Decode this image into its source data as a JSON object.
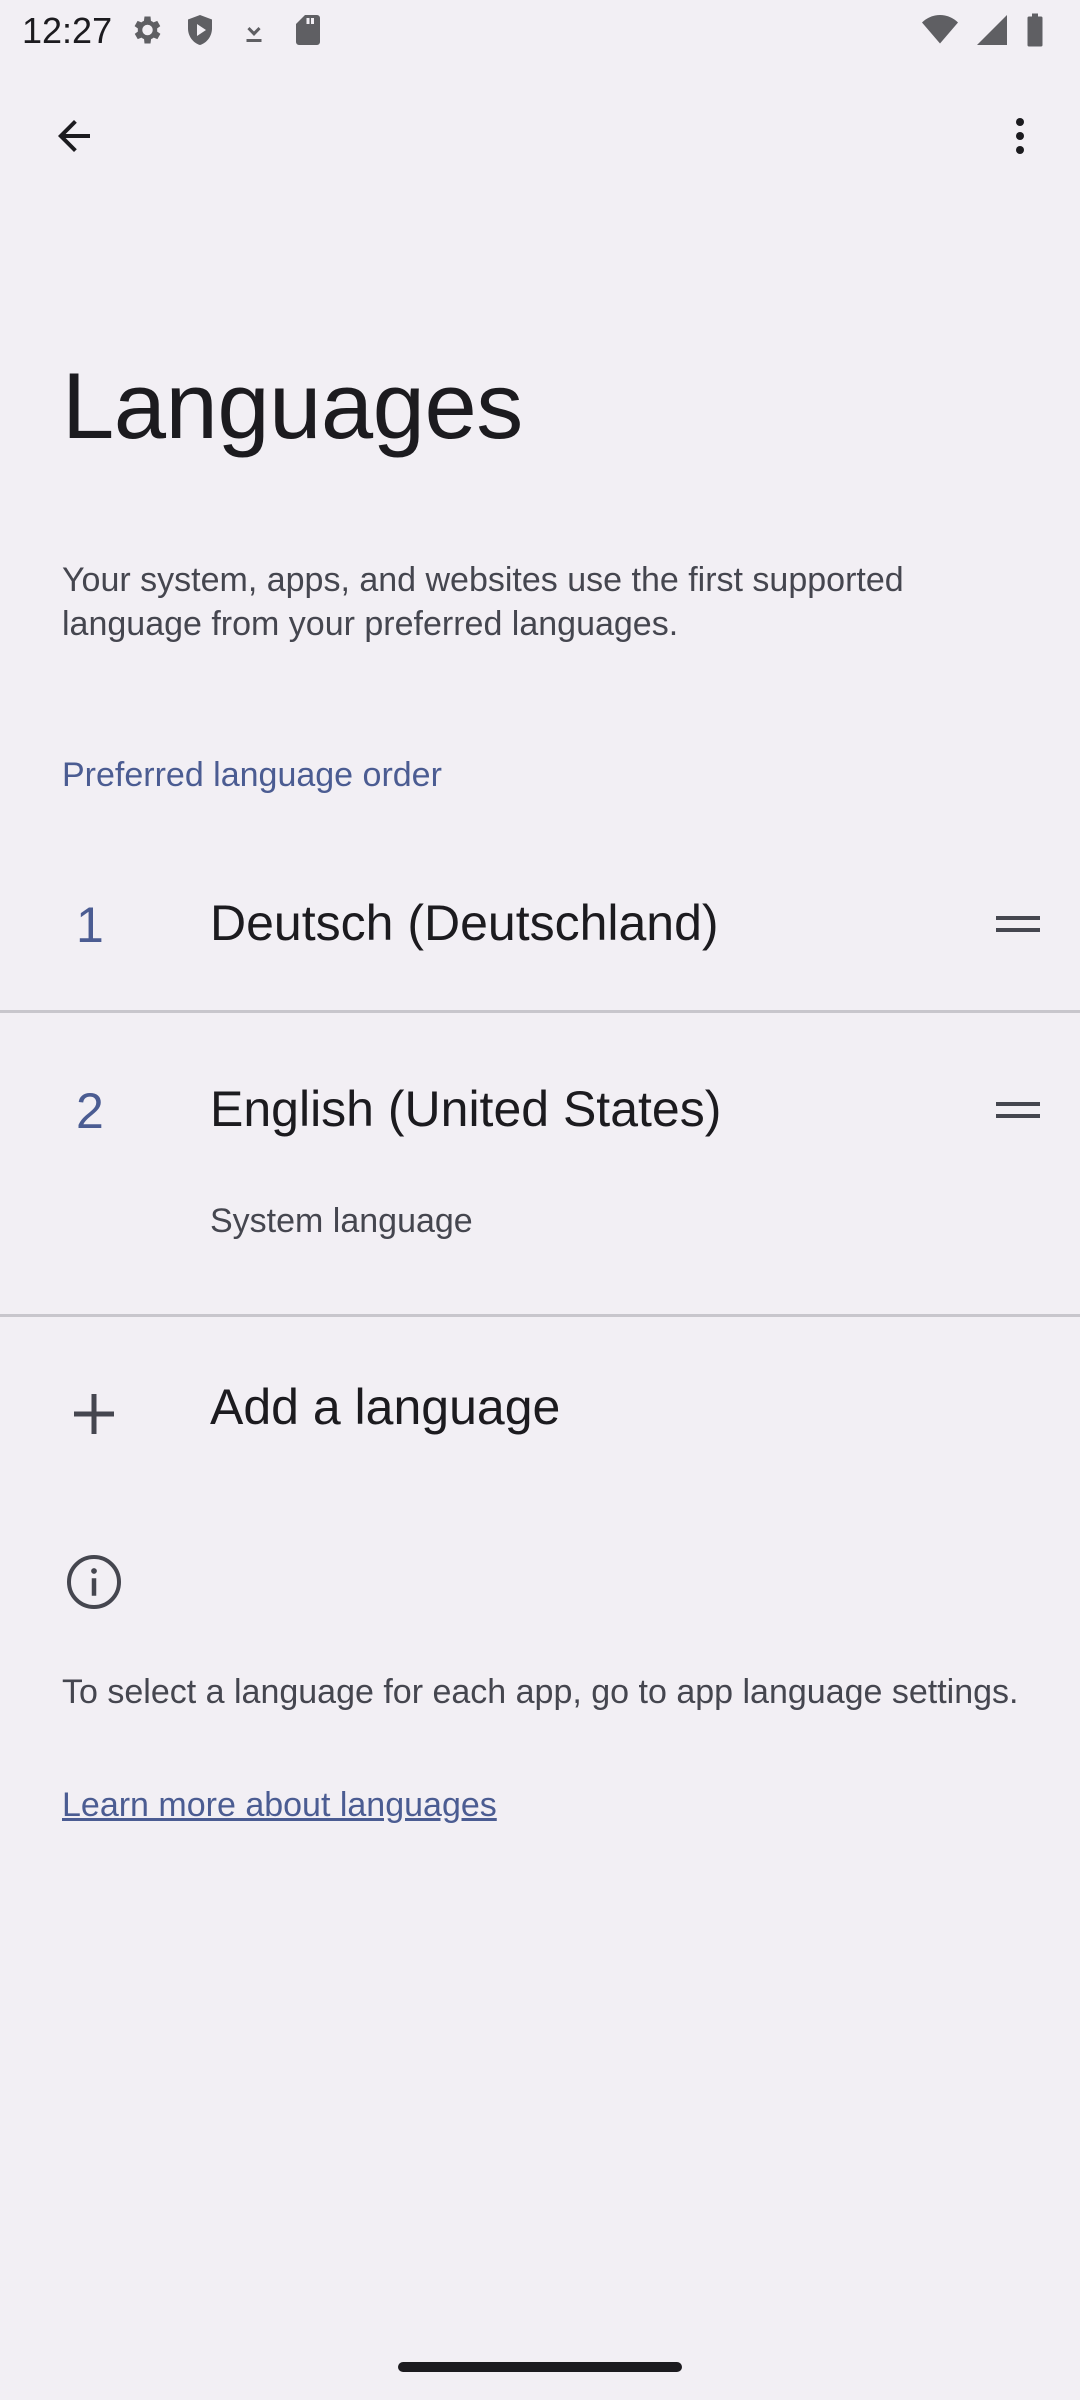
{
  "status_bar": {
    "time": "12:27",
    "left_icons": [
      "settings-icon",
      "shield-play-icon",
      "download-icon",
      "sd-card-icon"
    ],
    "right_icons": [
      "wifi-icon",
      "signal-icon",
      "battery-icon"
    ]
  },
  "toolbar": {
    "back_icon": "arrow-back-icon",
    "more_icon": "more-vert-icon"
  },
  "page": {
    "title": "Languages",
    "description": "Your system, apps, and websites use the first supported language from your preferred languages."
  },
  "preferred": {
    "header": "Preferred language order",
    "languages": [
      {
        "number": "1",
        "name": "Deutsch (Deutschland)",
        "subtitle": ""
      },
      {
        "number": "2",
        "name": "English (United States)",
        "subtitle": "System language"
      }
    ]
  },
  "add_language": {
    "label": "Add a language",
    "icon": "plus-icon"
  },
  "footer": {
    "info_icon": "info-icon",
    "text": "To select a language for each app, go to app language settings.",
    "link": "Learn more about languages"
  },
  "colors": {
    "background": "#f2eff4",
    "accent": "#4b5c92",
    "text_primary": "#1c1b1f",
    "text_secondary": "#45464f"
  }
}
